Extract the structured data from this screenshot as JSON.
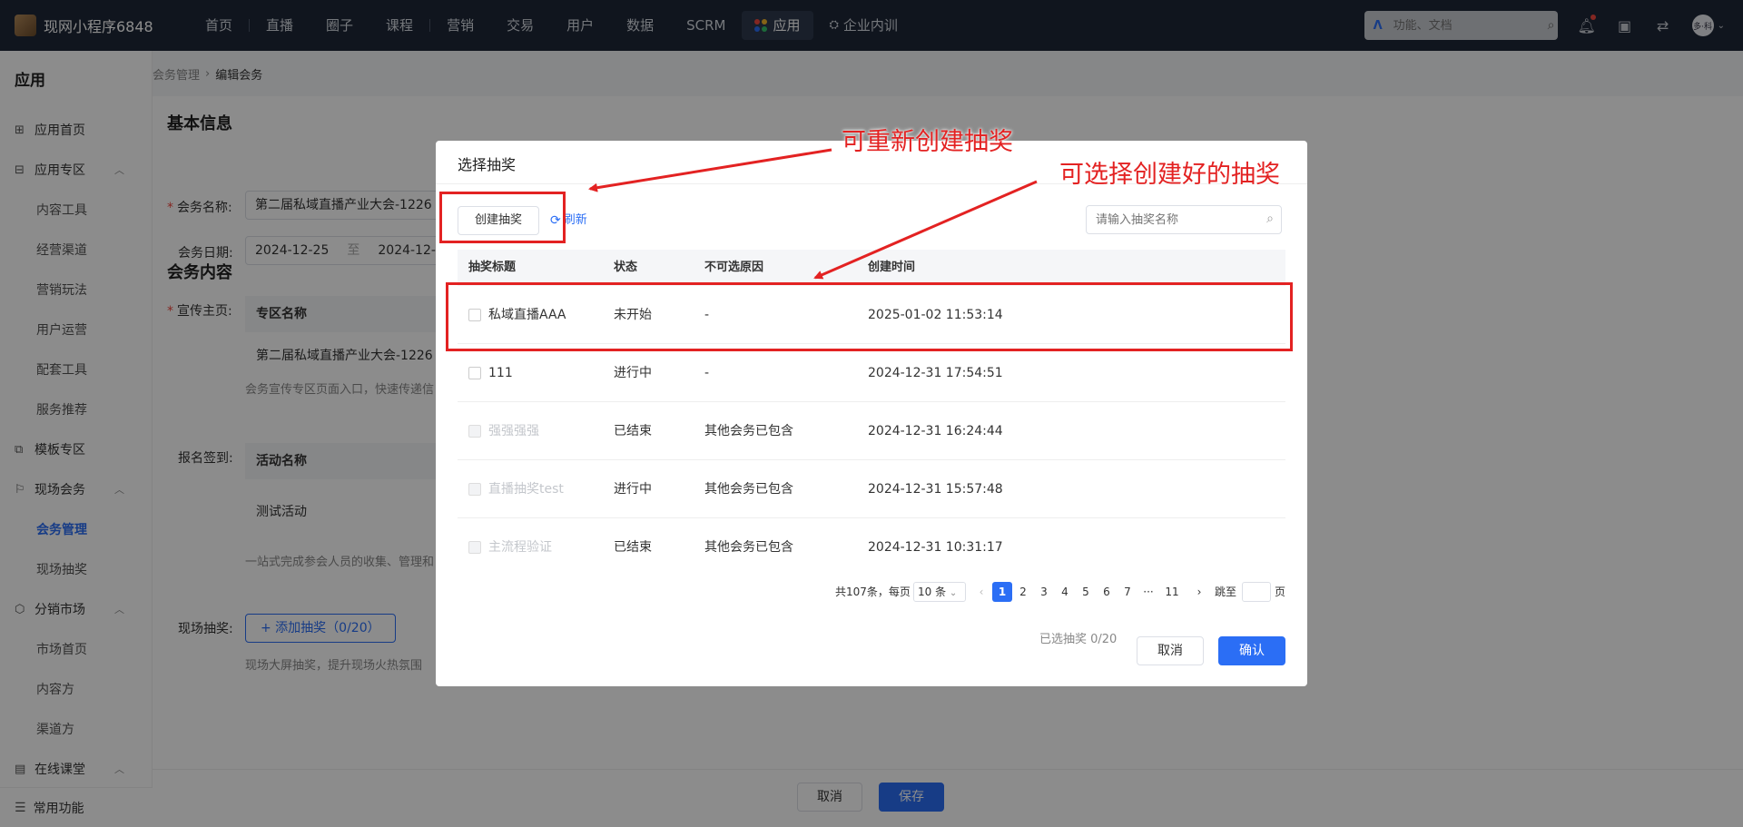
{
  "topnav": {
    "brand": "现网小程序6848",
    "items": [
      "首页",
      "直播",
      "圈子",
      "课程",
      "营销",
      "交易",
      "用户",
      "数据",
      "SCRM"
    ],
    "active_item": "应用",
    "extra_item": "企业内训",
    "search_placeholder": "功能、文档",
    "avatar_text": "多·科"
  },
  "sidebar": {
    "title": "应用",
    "items": [
      {
        "label": "应用首页"
      },
      {
        "label": "应用专区"
      },
      {
        "label": "内容工具"
      },
      {
        "label": "经营渠道"
      },
      {
        "label": "营销玩法"
      },
      {
        "label": "用户运营"
      },
      {
        "label": "配套工具"
      },
      {
        "label": "服务推荐"
      },
      {
        "label": "模板专区"
      },
      {
        "label": "现场会务"
      },
      {
        "label": "会务管理"
      },
      {
        "label": "现场抽奖"
      },
      {
        "label": "分销市场"
      },
      {
        "label": "市场首页"
      },
      {
        "label": "内容方"
      },
      {
        "label": "渠道方"
      },
      {
        "label": "在线课堂"
      }
    ],
    "bottom": "常用功能"
  },
  "breadcrumb": {
    "parent": "会务管理",
    "sep": "›",
    "current": "编辑会务"
  },
  "form": {
    "basic_title": "基本信息",
    "name_label": "会务名称:",
    "name_value": "第二届私域直播产业大会-1226",
    "date_label": "会务日期:",
    "date_start": "2024-12-25",
    "date_to": "至",
    "date_end": "2024-12-26",
    "content_title": "会务内容",
    "promo_label": "宣传主页:",
    "promo_col": "专区名称",
    "promo_value": "第二届私域直播产业大会-1226",
    "promo_hint": "会务宣传专区页面入口，快速传递信",
    "signup_label": "报名签到:",
    "signup_col": "活动名称",
    "signup_value": "测试活动",
    "signup_hint": "一站式完成参会人员的收集、管理和",
    "lottery_label": "现场抽奖:",
    "add_lottery": "+ 添加抽奖（0/20）",
    "lottery_hint": "现场大屏抽奖，提升现场火热氛围"
  },
  "footer": {
    "cancel": "取消",
    "save": "保存"
  },
  "modal": {
    "title": "选择抽奖",
    "create_button": "创建抽奖",
    "refresh": "刷新",
    "search_placeholder": "请输入抽奖名称",
    "columns": [
      "抽奖标题",
      "状态",
      "不可选原因",
      "创建时间"
    ],
    "rows": [
      {
        "title": "私域直播AAA",
        "status": "未开始",
        "reason": "-",
        "created": "2025-01-02 11:53:14",
        "disabled": false
      },
      {
        "title": "111",
        "status": "进行中",
        "reason": "-",
        "created": "2024-12-31 17:54:51",
        "disabled": false
      },
      {
        "title": "强强强强",
        "status": "已结束",
        "reason": "其他会务已包含",
        "created": "2024-12-31 16:24:44",
        "disabled": true
      },
      {
        "title": "直播抽奖test",
        "status": "进行中",
        "reason": "其他会务已包含",
        "created": "2024-12-31 15:57:48",
        "disabled": true
      },
      {
        "title": "主流程验证",
        "status": "已结束",
        "reason": "其他会务已包含",
        "created": "2024-12-31 10:31:17",
        "disabled": true
      }
    ],
    "pagination": {
      "total": "共107条，每页",
      "page_size": "10 条",
      "pages": [
        "1",
        "2",
        "3",
        "4",
        "5",
        "6",
        "7",
        "···",
        "11"
      ],
      "current_page": "1",
      "jump_label": "跳至",
      "page_unit": "页"
    },
    "selected_text": "已选抽奖 0/20",
    "cancel": "取消",
    "confirm": "确认"
  },
  "annotations": {
    "recreate": "可重新创建抽奖",
    "choose": "可选择创建好的抽奖"
  },
  "colors": {
    "accent": "#2b6ef5",
    "annotation": "#e32222",
    "nav_bg": "#1e2737"
  }
}
